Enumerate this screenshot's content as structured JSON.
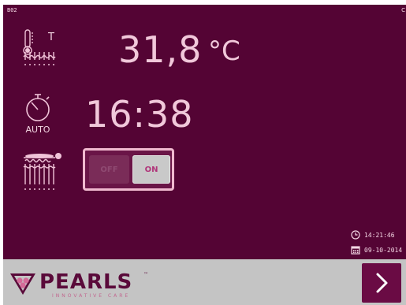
{
  "header": {
    "screen_id": "B02",
    "corner_mark": "C"
  },
  "temperature": {
    "icon_label": "T",
    "value": "31,8",
    "unit": "°C"
  },
  "timer": {
    "mode_label": "AUTO",
    "value": "16:38"
  },
  "mattress_toggle": {
    "off_label": "OFF",
    "on_label": "ON",
    "state": "on"
  },
  "status": {
    "clock": "14:21:46",
    "date": "09-10-2014"
  },
  "footer": {
    "brand": "PEARLS",
    "trademark": "™",
    "tagline": "INNOVATIVE CARE"
  },
  "icons": {
    "thermometer": "thermometer-icon",
    "stopwatch": "stopwatch-icon",
    "mattress": "mattress-heating-icon",
    "clock": "clock-icon",
    "calendar": "calendar-icon",
    "next": "chevron-right-icon"
  },
  "colors": {
    "screen_bg": "#540434",
    "text_pink": "#f1c8da",
    "footer_bg": "#c4c4c4",
    "brand_purple": "#5a0a3a",
    "toggle_on_bg": "#c9c9c9"
  }
}
